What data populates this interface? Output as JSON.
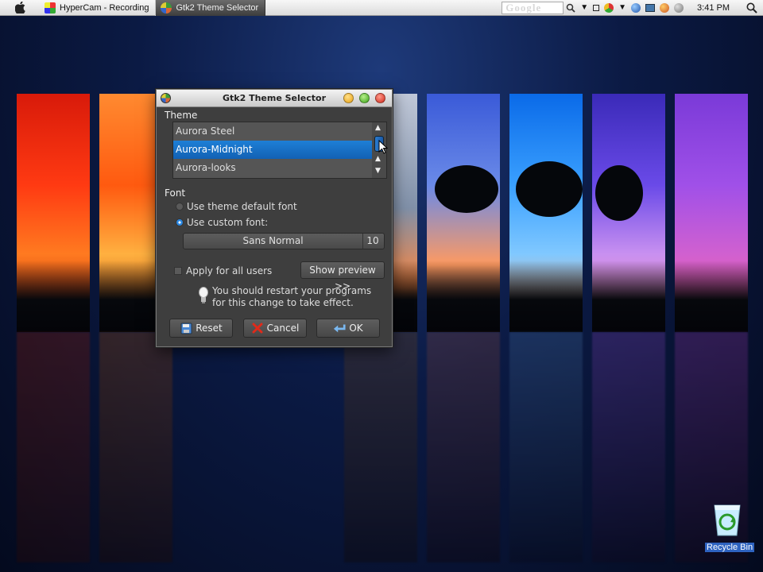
{
  "menubar": {
    "tasks": [
      {
        "label": "HyperCam - Recording"
      },
      {
        "label": "Gtk2 Theme Selector"
      }
    ],
    "search_logo": "Google",
    "clock": "3:41 PM"
  },
  "dialog": {
    "title": "Gtk2 Theme Selector",
    "theme_label": "Theme",
    "themes": [
      {
        "label": "Aurora Steel"
      },
      {
        "label": "Aurora-Midnight"
      },
      {
        "label": "Aurora-looks"
      }
    ],
    "selected_theme": "Aurora-Midnight",
    "font_label": "Font",
    "use_default_font": "Use theme default font",
    "use_custom_font": "Use custom font:",
    "font_name": "Sans Normal",
    "font_size": "10",
    "apply_all_users": "Apply for all users",
    "show_preview": "Show preview >>",
    "hint_line1": "You should restart your programs",
    "hint_line2": "for this change to take effect.",
    "reset": "Reset",
    "cancel": "Cancel",
    "ok": "OK"
  },
  "desktop": {
    "recycle_bin": "Recycle Bin"
  },
  "colors": {
    "selection": "#1a6fc8",
    "dialog_bg": "#3e3e3e",
    "recycle_label_bg": "#2e63c0"
  }
}
